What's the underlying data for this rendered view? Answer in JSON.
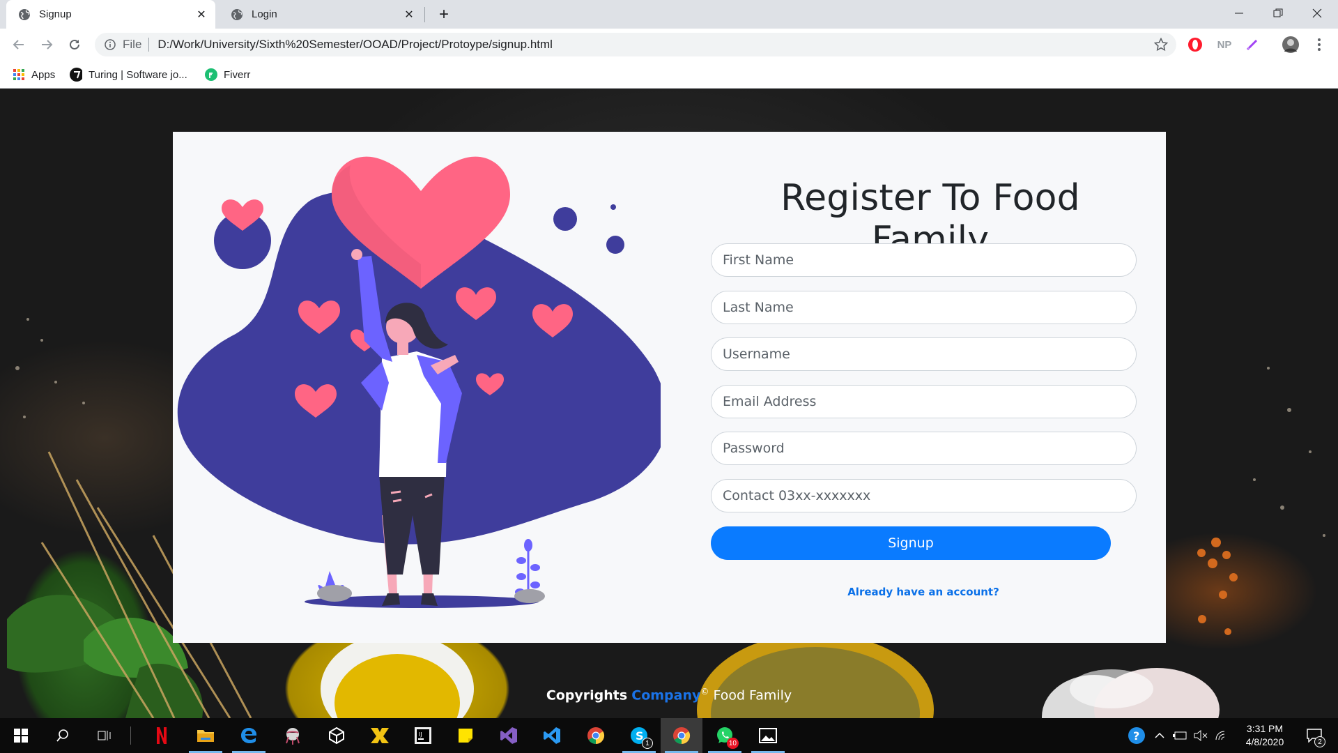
{
  "browser": {
    "tabs": [
      {
        "label": "Signup",
        "active": true
      },
      {
        "label": "Login",
        "active": false
      }
    ],
    "address": {
      "scheme_chip": "File",
      "url": "D:/Work/University/Sixth%20Semester/OOAD/Project/Protoype/signup.html"
    },
    "extensions": {
      "np_label": "NP"
    },
    "bookmarks": [
      {
        "label": "Apps",
        "icon": "apps-grid-icon"
      },
      {
        "label": "Turing | Software jo...",
        "icon": "turing-icon"
      },
      {
        "label": "Fiverr",
        "icon": "fiverr-icon"
      }
    ]
  },
  "page": {
    "title": "Register To Food Family",
    "fields": {
      "first_name": "First Name",
      "last_name": "Last Name",
      "username": "Username",
      "email": "Email Address",
      "password": "Password",
      "contact": "Contact 03xx-xxxxxxx"
    },
    "signup_label": "Signup",
    "account_link": "Already have an account?",
    "footer": {
      "prefix": "Copyrights",
      "brand": "Company",
      "symbol": "©",
      "suffix": "Food Family"
    },
    "colors": {
      "primary": "#0a7bff",
      "illustration_blob": "#3f3d9c",
      "heart": "#ff6584"
    }
  },
  "taskbar": {
    "apps": [
      "start-icon",
      "search-icon",
      "task-view-icon",
      "netflix-icon",
      "file-explorer-icon",
      "edge-icon",
      "app-icon",
      "unity-icon",
      "app-icon-2",
      "jetbrains-icon",
      "sticky-notes-icon",
      "visual-studio-icon",
      "vscode-icon",
      "chrome-icon",
      "skype-icon",
      "chrome-active-icon",
      "whatsapp-icon",
      "photos-icon"
    ],
    "skype_badge": "1",
    "whatsapp_badge": "10",
    "notification_badge": "2",
    "time": "3:31 PM",
    "date": "4/8/2020"
  }
}
